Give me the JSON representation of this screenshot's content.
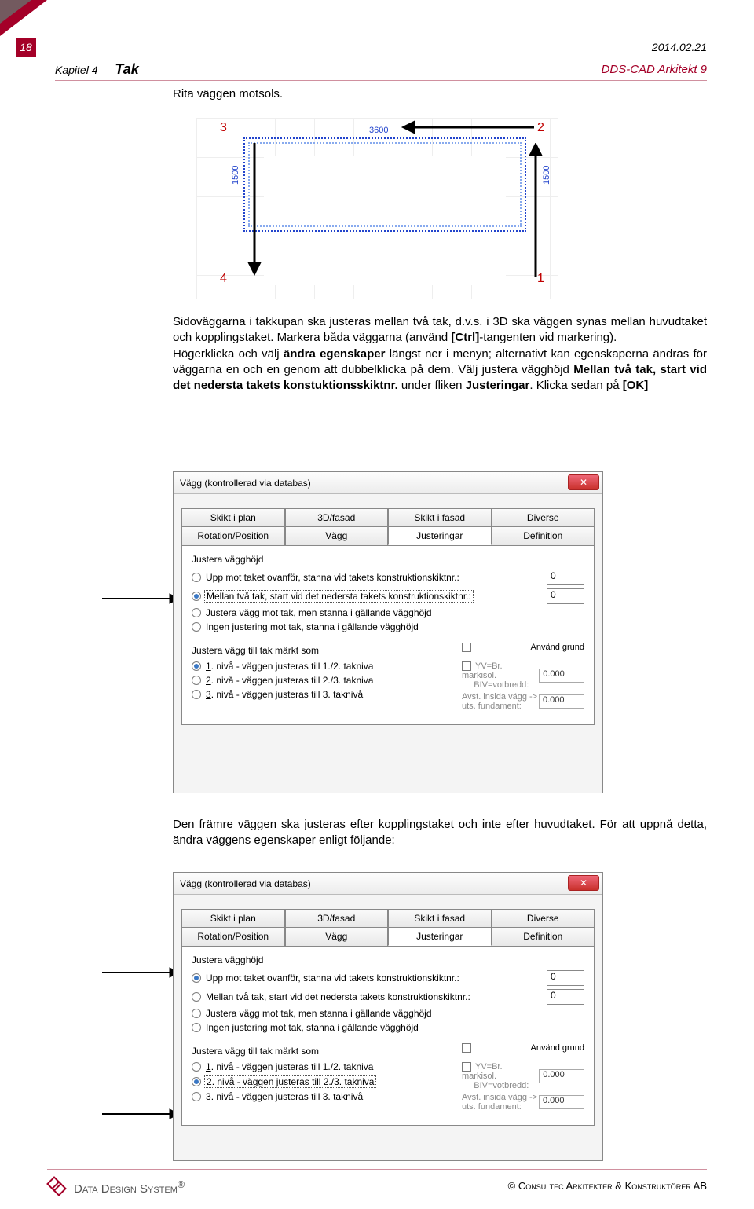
{
  "header": {
    "page_number": "18",
    "date": "2014.02.21",
    "chapter": "Kapitel 4",
    "section": "Tak",
    "product": "DDS-CAD Arkitekt 9"
  },
  "para1": "Rita väggen motsols.",
  "diagram": {
    "n1": "1",
    "n2": "2",
    "n3": "3",
    "n4": "4",
    "dim_top": "3600",
    "dim_left": "1500",
    "dim_right": "1500"
  },
  "para2_pre": "Sidoväggarna i takkupan ska justeras mellan två tak, d.v.s. i 3D ska väggen synas mellan huvudtaket och kopplingstaket. Markera båda väggarna (använd ",
  "para2_ctrl": "[Ctrl]",
  "para2_mid1": "-tangenten vid markering).",
  "para2_line2a": "Högerklicka och välj ",
  "para2_bold1": "ändra egenskaper",
  "para2_line2b": " längst ner i menyn; alternativt kan egenskaperna ändras för väggarna en och en genom att dubbelklicka på dem. Välj justera vägghöjd ",
  "para2_bold2": "Mellan två tak, start vid det nedersta takets konstuktionsskiktnr.",
  "para2_tail": " under fliken ",
  "para2_bold3": "Justeringar",
  "para2_end": ". Klicka sedan på ",
  "para2_ok": "[OK]",
  "dialog": {
    "title": "Vägg (kontrollerad via databas)",
    "close": "✕",
    "tabs_row1": [
      "Skikt i plan",
      "3D/fasad",
      "Skikt i fasad",
      "Diverse"
    ],
    "tabs_row2": [
      "Rotation/Position",
      "Vägg",
      "Justeringar",
      "Definition"
    ],
    "group1": "Justera vägghöjd",
    "radios1": [
      "Upp mot taket ovanför, stanna vid takets konstruktionskiktnr.:",
      "Mellan två tak, start vid det nedersta takets konstruktionskiktnr.:",
      "Justera vägg mot tak, men stanna i gällande vägghöjd",
      "Ingen justering mot tak, stanna i gällande vägghöjd"
    ],
    "val0": "0",
    "val1": "0",
    "group2": "Justera vägg till tak märkt som",
    "chk_label": "Använd grund",
    "radios2": [
      "1. nivå - väggen justeras till 1./2. takniva",
      "2. nivå - väggen justeras till 2./3. takniva",
      "3. nivå - väggen justeras till 3. taknivå"
    ],
    "right_lbl1": "YV=Br. markisol.",
    "right_lbl1b": "BIV=votbredd:",
    "right_lbl2a": "Avst. insida vägg  ->",
    "right_lbl2b": "uts. fundament:",
    "right_val": "0.000"
  },
  "para3_a": "Den främre väggen ska justeras efter kopplingstaket och inte efter huvudtaket. För att uppnå detta, ändra väggens egenskaper enligt följande:",
  "footer": {
    "brand": "Data Design System",
    "tm": "®",
    "right_pre": "© ",
    "right": "Consultec Arkitekter & Konstruktörer",
    "right_suf": " AB"
  }
}
